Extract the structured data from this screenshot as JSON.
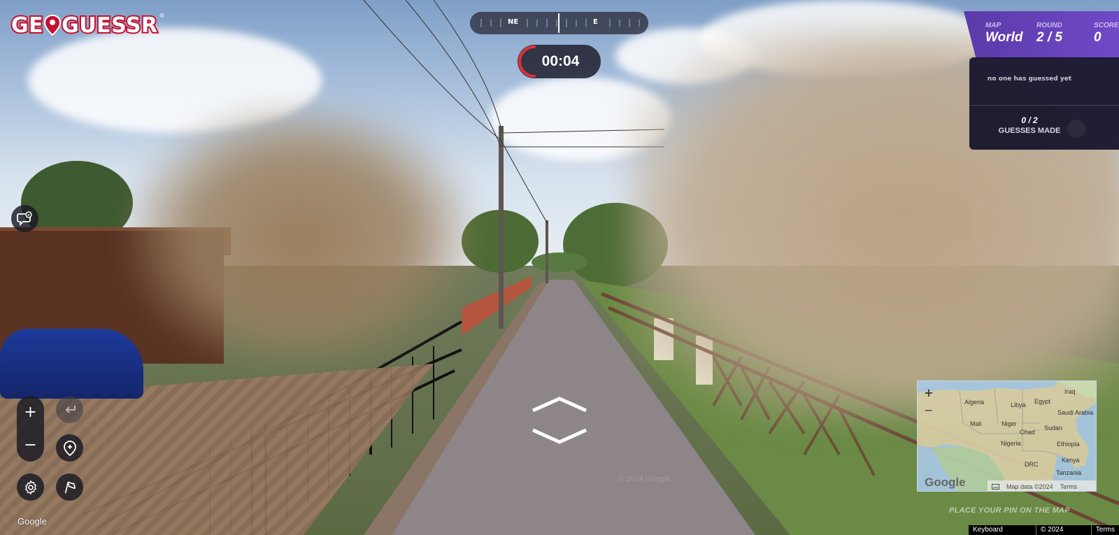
{
  "logo": {
    "text_left": "GE",
    "text_right": "GUESSR",
    "registered": "®"
  },
  "compass": {
    "labels": [
      "NE",
      "E"
    ]
  },
  "timer": {
    "value": "00:04"
  },
  "game_status": {
    "map_label": "MAP",
    "map_value": "World",
    "round_label": "ROUND",
    "round_value": "2 / 5",
    "score_label": "SCORE",
    "score_value": "0"
  },
  "guesses": {
    "empty_text": "no one has guessed yet",
    "count": "0 / 2",
    "label": "GUESSES MADE"
  },
  "controls": {
    "zoom_in": "+",
    "zoom_out": "−",
    "icons": [
      "chat-icon",
      "undo-icon",
      "add-pin-icon",
      "settings-icon",
      "flag-icon",
      "forward-arrow-icon",
      "backward-arrow-icon"
    ]
  },
  "minimap": {
    "labels": {
      "iraq": "Iraq",
      "algeria": "Algeria",
      "libya": "Libya",
      "egypt": "Egypt",
      "saudi": "Saudi Arabia",
      "mali": "Mali",
      "niger": "Niger",
      "chad": "Chad",
      "sudan": "Sudan",
      "nigeria": "Nigeria",
      "ethiopia": "Ethiopia",
      "drc": "DRC",
      "kenya": "Kenya",
      "tanzania": "Tanzania"
    },
    "zoom_in": "+",
    "zoom_out": "−",
    "google": "Google",
    "map_data": "Map data ©2024",
    "terms": "Terms",
    "hint": "PLACE YOUR PIN ON THE MAP"
  },
  "attribution": {
    "google": "Google",
    "keyboard_shortcuts": "Keyboard shortcuts",
    "copyright": "© 2024 Google",
    "terms": "Terms",
    "watermark": "© 2024 Google"
  },
  "colors": {
    "accent_purple": "#6a45c0",
    "logo_red": "#c8102e",
    "timer_red": "#e0303c"
  }
}
